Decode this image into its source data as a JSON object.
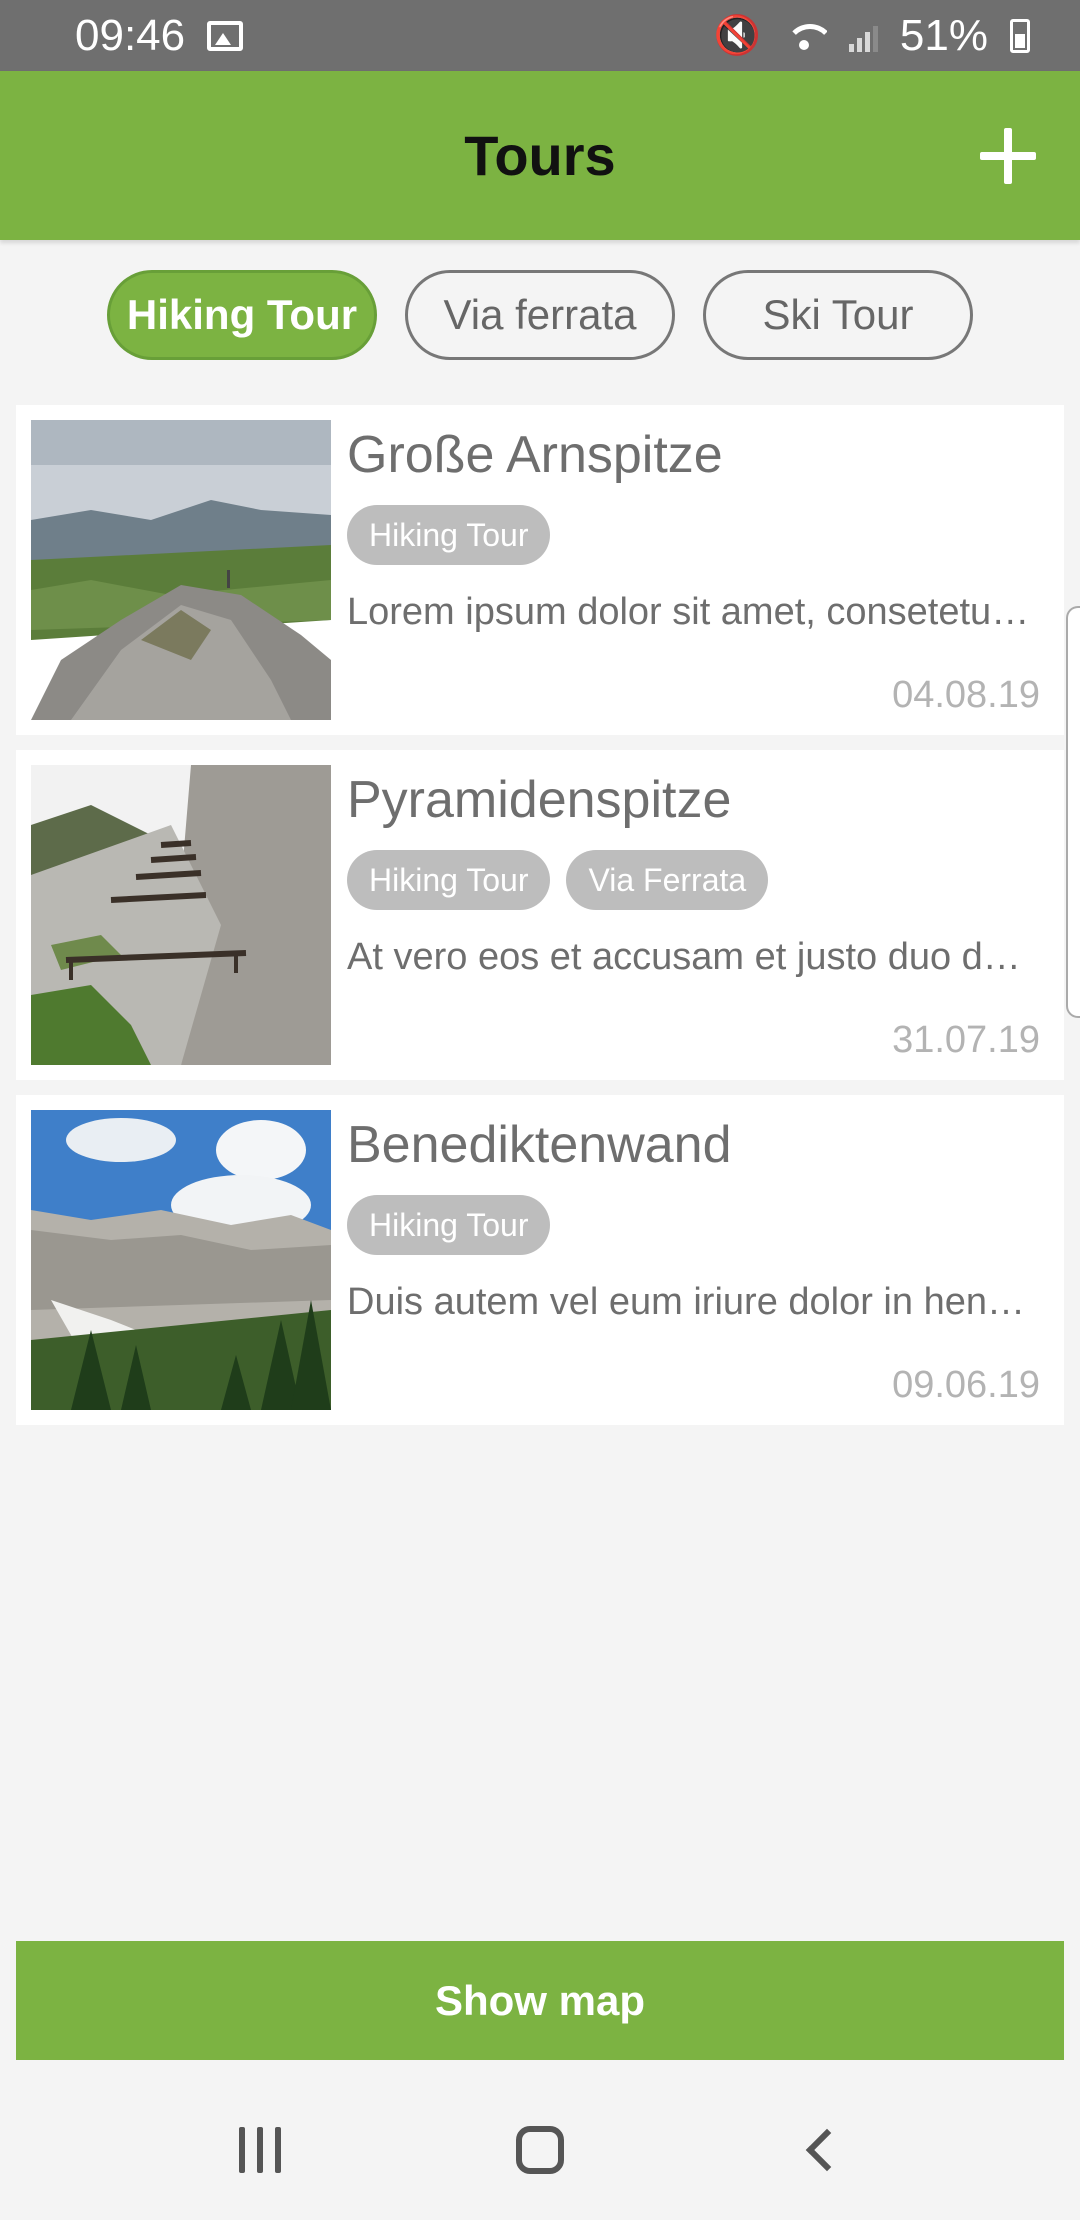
{
  "status_bar": {
    "time": "09:46",
    "battery": "51%",
    "icons": [
      "image-icon",
      "mute-icon",
      "wifi-icon",
      "signal-icon",
      "battery-icon"
    ]
  },
  "app_bar": {
    "title": "Tours",
    "add_icon": "plus-icon"
  },
  "filters": [
    {
      "label": "Hiking Tour",
      "active": true
    },
    {
      "label": "Via ferrata",
      "active": false
    },
    {
      "label": "Ski Tour",
      "active": false
    }
  ],
  "tours": [
    {
      "title": "Große Arnspitze",
      "tags": [
        "Hiking Tour"
      ],
      "description": "Lorem ipsum dolor sit amet, consetetur sadipscing elitr",
      "date": "04.08.19"
    },
    {
      "title": "Pyramidenspitze",
      "tags": [
        "Hiking Tour",
        "Via Ferrata"
      ],
      "description": "At vero eos et accusam et justo duo dolores",
      "date": "31.07.19"
    },
    {
      "title": "Benediktenwand",
      "tags": [
        "Hiking Tour"
      ],
      "description": " Duis autem vel eum iriure dolor in hendrerit",
      "date": "09.06.19"
    }
  ],
  "show_map_label": "Show map",
  "colors": {
    "accent": "#7cb342",
    "status_bar": "#6f6f6f",
    "tag": "#bdbdbd",
    "background": "#f4f4f4"
  }
}
